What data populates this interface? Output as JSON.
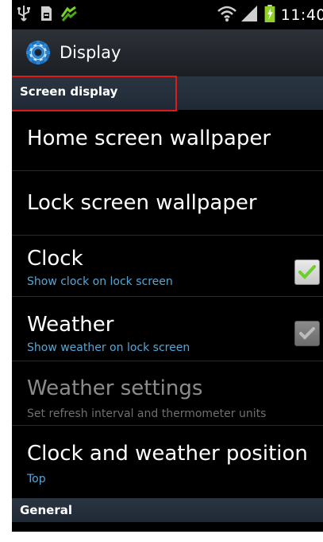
{
  "status_bar": {
    "time": "11:40",
    "icons": [
      "usb-icon",
      "sd-card-icon",
      "sync-icon",
      "wifi-icon",
      "signal-icon",
      "battery-charging-icon"
    ]
  },
  "action_bar": {
    "icon": "settings-gear-icon",
    "title": "Display"
  },
  "sections": [
    {
      "header": "Screen display",
      "items": [
        {
          "title": "Home screen wallpaper"
        },
        {
          "title": "Lock screen wallpaper"
        },
        {
          "title": "Clock",
          "summary": "Show clock on lock screen",
          "checked": true,
          "enabled": true
        },
        {
          "title": "Weather",
          "summary": "Show weather on lock screen",
          "checked": true,
          "enabled": false
        },
        {
          "title": "Weather settings",
          "summary": "Set refresh interval and thermometer units",
          "enabled": false
        },
        {
          "title": "Clock and weather position",
          "summary": "Top"
        }
      ]
    },
    {
      "header": "General",
      "items": []
    }
  ],
  "colors": {
    "accent": "#57a6d6",
    "check_green": "#6dcf2b",
    "highlight": "#e0191b"
  }
}
